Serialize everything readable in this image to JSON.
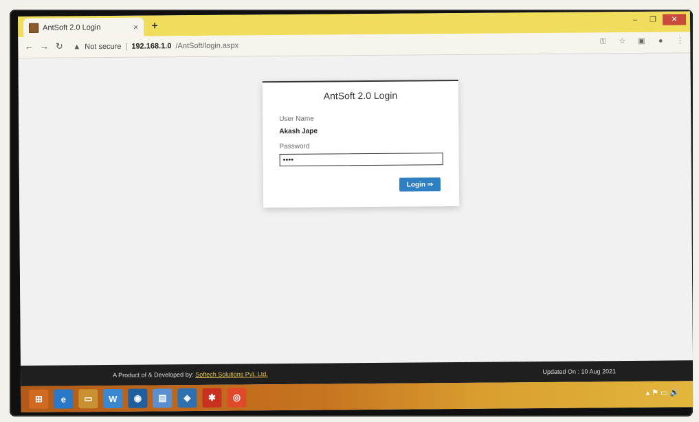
{
  "browser": {
    "tab_title": "AntSoft 2.0 Login",
    "tab_close": "×",
    "new_tab": "+",
    "url_security": "Not secure",
    "url_host": "192.168.1.0",
    "url_path": "/AntSoft/login.aspx",
    "window_controls": [
      "–",
      "❐",
      "✕"
    ]
  },
  "login": {
    "title": "AntSoft 2.0 Login",
    "user_label": "User Name",
    "user_value": "Akash Jape",
    "password_label": "Password",
    "password_value": "••••",
    "login_button": "Login ⇒"
  },
  "footer": {
    "left_text": "A Product of & Developed by:",
    "link_text": "Softech Solutions Pvt. Ltd.",
    "right_text": "Updated On : 10 Aug 2021"
  },
  "taskbar": {
    "tray_text": "▴ ⚑ ▭ 🔊"
  }
}
